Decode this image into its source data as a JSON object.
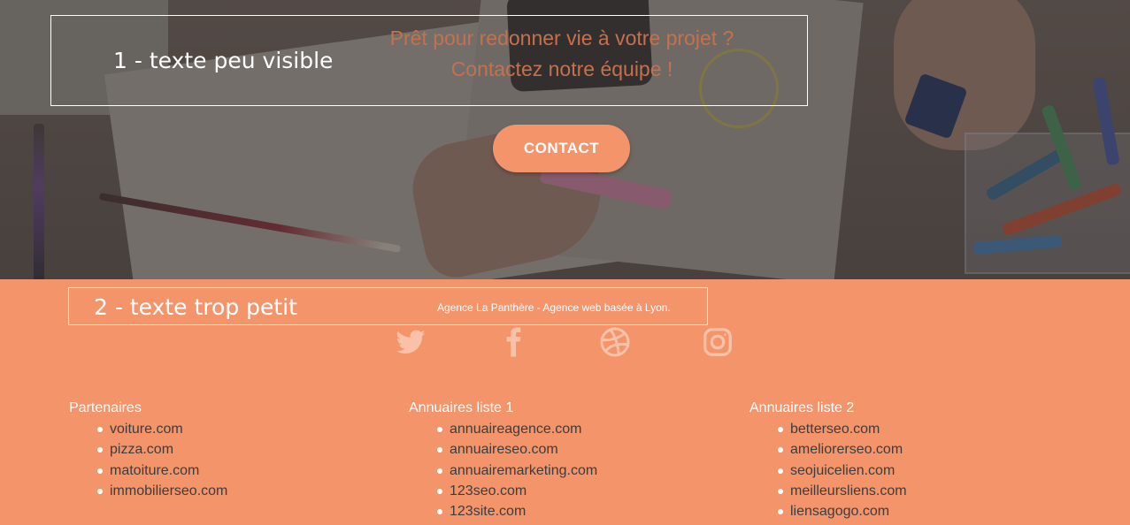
{
  "hero": {
    "label": "1 - texte peu visible",
    "headline_line1": "Prêt pour redonner vie à votre projet ?",
    "headline_line2": "Contactez notre équipe !",
    "contact_button": "CONTACT"
  },
  "footer": {
    "label": "2 - texte trop petit",
    "tagline": "Agence La Panthère - Agence web basée à Lyon.",
    "social_icons": [
      "twitter-icon",
      "facebook-icon",
      "dribbble-icon",
      "instagram-icon"
    ],
    "columns": [
      {
        "title": "Partenaires",
        "links": [
          "voiture.com",
          "pizza.com",
          "matoiture.com",
          "immobilierseo.com"
        ]
      },
      {
        "title": "Annuaires liste 1",
        "links": [
          "annuaireagence.com",
          "annuaireseo.com",
          "annuairemarketing.com",
          "123seo.com",
          "123site.com"
        ]
      },
      {
        "title": "Annuaires liste 2",
        "links": [
          "betterseo.com",
          "ameliorerseo.com",
          "seojuicelien.com",
          "meilleursliens.com",
          "liensagogo.com"
        ]
      }
    ]
  },
  "colors": {
    "accent": "#f3946b",
    "headline": "#c3714e",
    "link_text": "#3d3d3d"
  }
}
